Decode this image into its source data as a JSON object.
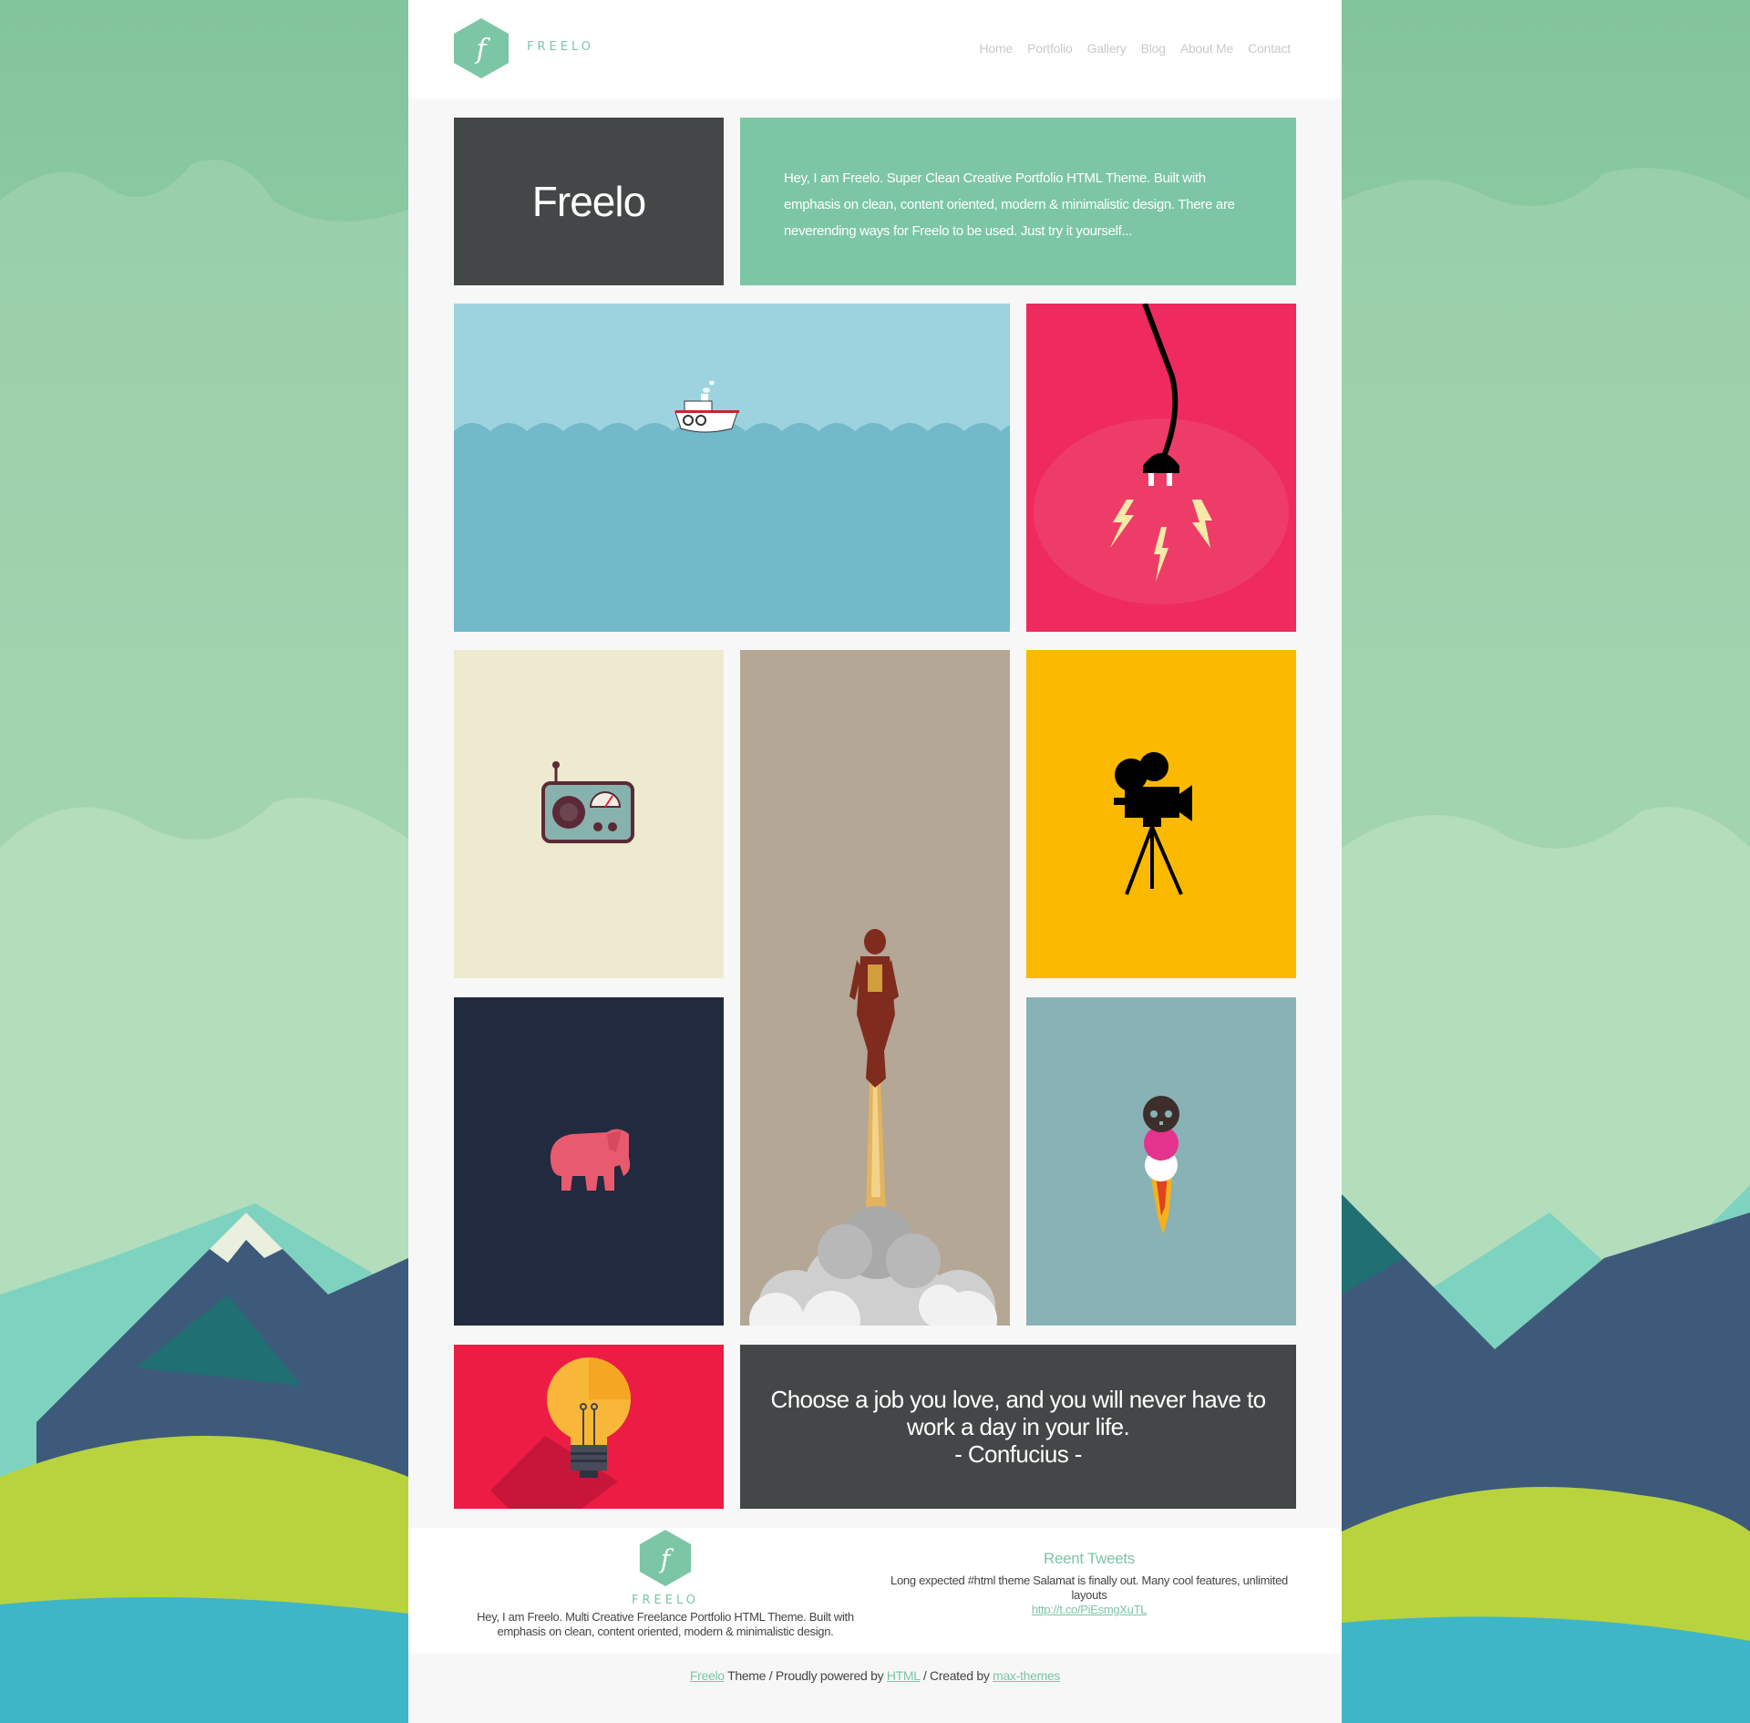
{
  "brand": {
    "name": "FREELO"
  },
  "nav": [
    {
      "label": "Home"
    },
    {
      "label": "Portfolio"
    },
    {
      "label": "Gallery"
    },
    {
      "label": "Blog"
    },
    {
      "label": "About Me"
    },
    {
      "label": "Contact"
    }
  ],
  "hero": {
    "title": "Freelo",
    "intro": "Hey, I am Freelo. Super Clean Creative Portfolio HTML Theme. Built with emphasis on clean, content oriented, modern & minimalistic design. There are neverending ways for Freelo to be used. Just try it yourself..."
  },
  "portfolio": [
    {
      "icon": "boat-icon",
      "color": "#9dd3df"
    },
    {
      "icon": "plug-icon",
      "color": "#ef2a5e"
    },
    {
      "icon": "radio-icon",
      "color": "#edeacf"
    },
    {
      "icon": "rocket-man-icon",
      "color": "#b4a795"
    },
    {
      "icon": "film-camera-icon",
      "color": "#fbba00"
    },
    {
      "icon": "elephant-icon",
      "color": "#222a3f"
    },
    {
      "icon": "skull-rocket-icon",
      "color": "#88b2b5"
    },
    {
      "icon": "lightbulb-icon",
      "color": "#ec1c45"
    }
  ],
  "quote": {
    "line1": "Choose a job you love, and you will never have to work a day in your life.",
    "author": "- Confucius -"
  },
  "footer": {
    "brand": "FREELO",
    "description": "Hey, I am Freelo. Multi Creative Freelance Portfolio HTML Theme. Built with emphasis on clean, content oriented, modern & minimalistic design.",
    "tweets_title": "Reent Tweets",
    "tweet_text": "Long expected #html theme Salamat is finally out. Many cool features, unlimited layouts",
    "tweet_link": "http://t.co/PiEsmgXuTL"
  },
  "credits": {
    "theme_link": "Freelo",
    "text1": " Theme / Proudly powered by ",
    "html_link": "HTML",
    "text2": " / Created by ",
    "author_link": "max-themes"
  },
  "colors": {
    "accent": "#7cc6a6",
    "dark": "#434747"
  }
}
